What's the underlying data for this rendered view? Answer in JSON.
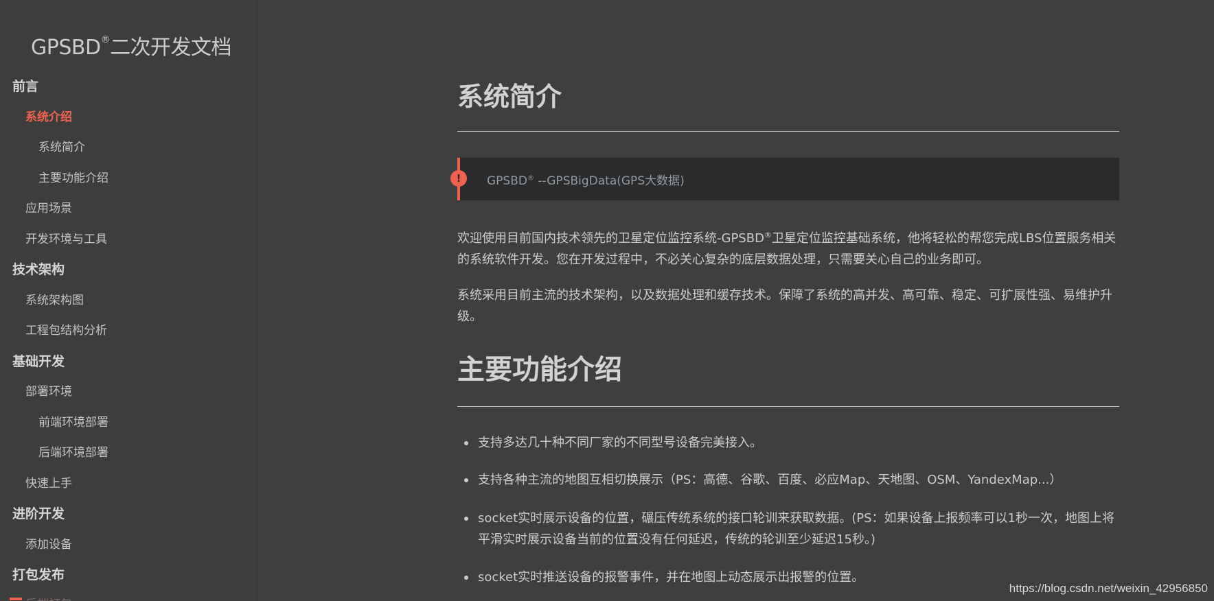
{
  "sidebar": {
    "title_main": "GPSBD",
    "title_mark": "®",
    "title_rest": "二次开发文档",
    "nav": [
      {
        "label": "前言",
        "level": 0
      },
      {
        "label": "系统介绍",
        "level": 1,
        "active": true
      },
      {
        "label": "系统简介",
        "level": 2
      },
      {
        "label": "主要功能介绍",
        "level": 2
      },
      {
        "label": "应用场景",
        "level": 1
      },
      {
        "label": "开发环境与工具",
        "level": 1
      },
      {
        "label": "技术架构",
        "level": 0
      },
      {
        "label": "系统架构图",
        "level": 1
      },
      {
        "label": "工程包结构分析",
        "level": 1
      },
      {
        "label": "基础开发",
        "level": 0
      },
      {
        "label": "部署环境",
        "level": 1
      },
      {
        "label": "前端环境部署",
        "level": 2
      },
      {
        "label": "后端环境部署",
        "level": 2
      },
      {
        "label": "快速上手",
        "level": 1
      },
      {
        "label": "进阶开发",
        "level": 0
      },
      {
        "label": "添加设备",
        "level": 1
      },
      {
        "label": "打包发布",
        "level": 0
      },
      {
        "label": "后端打包",
        "level": 1,
        "cut": true
      }
    ]
  },
  "content": {
    "section1_title": "系统简介",
    "notice_icon": "!",
    "notice_main": "GPSBD",
    "notice_mark": "®",
    "notice_rest": " --GPSBigData(GPS大数据)",
    "para1_a": "欢迎使用目前国内技术领先的卫星定位监控系统-GPSBD",
    "para1_mark": "®",
    "para1_b": "卫星定位监控基础系统，他将轻松的帮您完成LBS位置服务相关的系统软件开发。您在开发过程中，不必关心复杂的底层数据处理，只需要关心自己的业务即可。",
    "para2": "系统采用目前主流的技术架构，以及数据处理和缓存技术。保障了系统的高并发、高可靠、稳定、可扩展性强、易维护升级。",
    "section2_title": "主要功能介绍",
    "features": [
      "支持多达几十种不同厂家的不同型号设备完美接入。",
      "支持各种主流的地图互相切换展示（PS：高德、谷歌、百度、必应Map、天地图、OSM、YandexMap...）",
      "socket实时展示设备的位置，碾压传统系统的接口轮训来获取数据。(PS：如果设备上报频率可以1秒一次，地图上将平滑实时展示设备当前的位置没有任何延迟，传统的轮训至少延迟15秒。)",
      "socket实时推送设备的报警事件，并在地图上动态展示出报警的位置。"
    ]
  },
  "watermark": "https://blog.csdn.net/weixin_42956850",
  "colors": {
    "background": "#3f3f3f",
    "accent": "#f0624f",
    "notice_bg": "#2b2b2b"
  }
}
